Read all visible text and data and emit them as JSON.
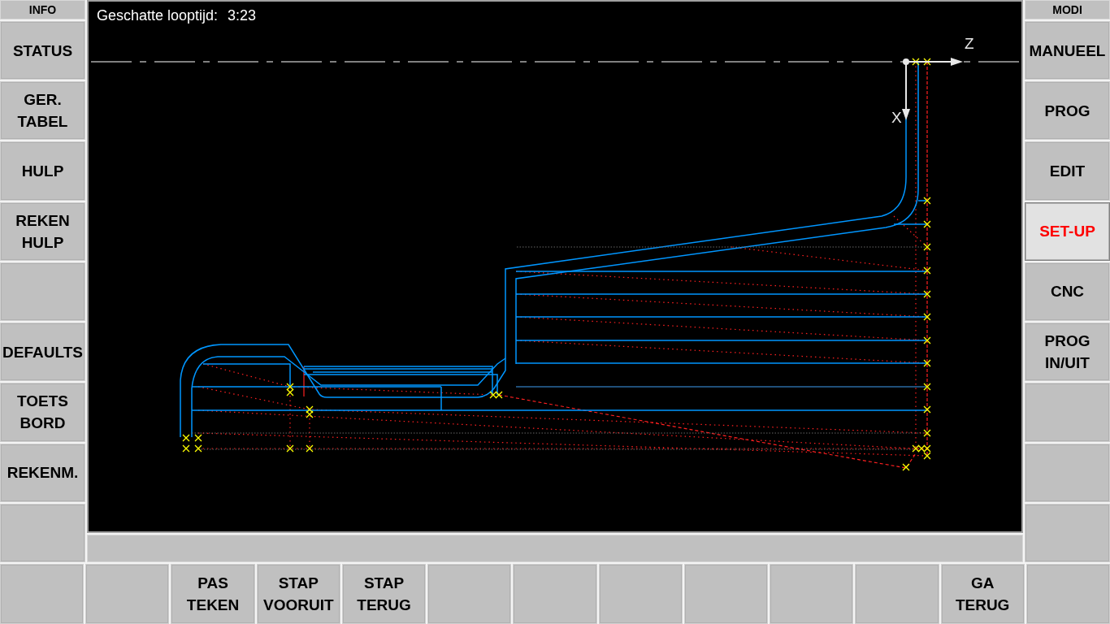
{
  "info_panel": {
    "title": "INFO",
    "keys": [
      {
        "kind": "key",
        "lines": [
          "STATUS"
        ]
      },
      {
        "kind": "key",
        "lines": [
          "GER.",
          "TABEL"
        ]
      },
      {
        "kind": "key",
        "lines": [
          "HULP"
        ]
      },
      {
        "kind": "key",
        "lines": [
          "REKEN",
          "HULP"
        ]
      },
      {
        "kind": "blank"
      },
      {
        "kind": "key",
        "lines": [
          "DEFAULTS"
        ]
      },
      {
        "kind": "key",
        "lines": [
          "TOETS",
          "BORD"
        ]
      },
      {
        "kind": "key",
        "lines": [
          "REKENM."
        ]
      },
      {
        "kind": "blank"
      }
    ]
  },
  "graphic": {
    "runtime_label": "Geschatte looptijd:",
    "runtime_value": "3:23",
    "axis_z": "Z",
    "axis_x": "X"
  },
  "modi_panel": {
    "title": "MODI",
    "keys": [
      {
        "kind": "key",
        "lines": [
          "MANUEEL"
        ],
        "selected": false
      },
      {
        "kind": "key",
        "lines": [
          "PROG"
        ],
        "selected": false
      },
      {
        "kind": "key",
        "lines": [
          "EDIT"
        ],
        "selected": false
      },
      {
        "kind": "key",
        "lines": [
          "SET-UP"
        ],
        "selected": true
      },
      {
        "kind": "key",
        "lines": [
          "CNC"
        ],
        "selected": false
      },
      {
        "kind": "key",
        "lines": [
          "PROG",
          "IN/UIT"
        ],
        "selected": false
      },
      {
        "kind": "blank",
        "selected": false
      },
      {
        "kind": "blank",
        "selected": false
      },
      {
        "kind": "blank",
        "selected": false
      }
    ]
  },
  "softkeys": [
    {
      "kind": "blank"
    },
    {
      "kind": "blank"
    },
    {
      "kind": "key",
      "lines": [
        "PAS",
        "TEKEN"
      ]
    },
    {
      "kind": "key",
      "lines": [
        "STAP",
        "VOORUIT"
      ]
    },
    {
      "kind": "key",
      "lines": [
        "STAP",
        "TERUG"
      ]
    },
    {
      "kind": "blank"
    },
    {
      "kind": "blank"
    },
    {
      "kind": "blank"
    },
    {
      "kind": "blank"
    },
    {
      "kind": "blank"
    },
    {
      "kind": "blank"
    },
    {
      "kind": "key",
      "lines": [
        "GA",
        "TERUG"
      ]
    },
    {
      "kind": "blank"
    }
  ]
}
